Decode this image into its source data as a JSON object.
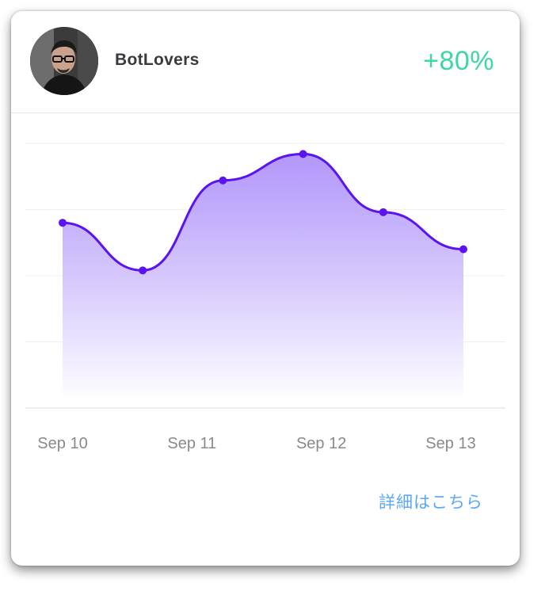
{
  "header": {
    "username": "BotLovers",
    "change": "+80%"
  },
  "avatar": {
    "kind": "user-photo",
    "description_icon": "avatar-icon"
  },
  "link": {
    "details_label": "詳細はこちら"
  },
  "colors": {
    "line": "#5a14f0",
    "area_top": "#a98cfa",
    "area_bottom": "#ffffff",
    "grid": "#efeff2",
    "axis": "#dcdcdf",
    "tick_text": "#8a8a8e",
    "change_text": "#3fd6a6",
    "link_text": "#5ba8f5"
  },
  "chart_data": {
    "type": "area",
    "title": "",
    "xlabel": "",
    "ylabel": "",
    "grid": true,
    "legend": "none",
    "x_ticks": [
      "Sep 10",
      "Sep 11",
      "Sep 12",
      "Sep 13"
    ],
    "ylim": [
      0,
      100
    ],
    "series": [
      {
        "values": [
          70,
          52,
          86,
          96,
          74,
          60
        ]
      }
    ]
  }
}
